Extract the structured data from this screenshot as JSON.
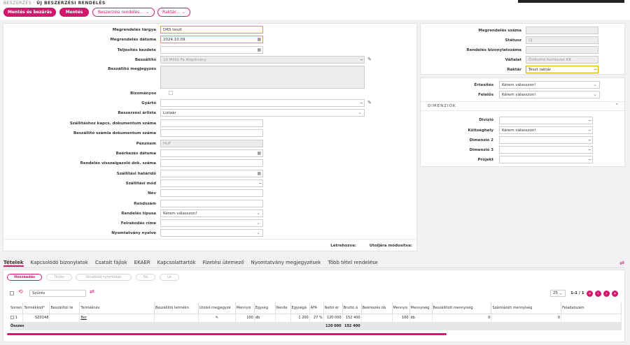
{
  "breadcrumb": {
    "root": "BESZERZÉS",
    "sep": "·",
    "current": "ÚJ BESZERZÉSI RENDELÉS"
  },
  "toolbar": {
    "save_close": "Mentés és bezárás",
    "save": "Mentés",
    "orders_menu": "Beszerzési rendelés...",
    "warehouse_menu": "Raktár..."
  },
  "form": {
    "subject_label": "Megrendelés tárgya",
    "subject_value": "DRS teszt",
    "date_label": "Megrendelés dátuma",
    "date_value": "2024.10.09.",
    "start_label": "Teljesítés kezdete",
    "start_value": "",
    "supplier_label": "Beszállító",
    "supplier_value": "10 Millió Fa Alapítvány",
    "note_label": "Beszállító megjegyzés",
    "consign_label": "Bizományos",
    "maker_label": "Gyártó",
    "pricelist_label": "Beszerzési árlista",
    "pricelist_value": "Listaár",
    "supdoc_label": "Szállításhoz kapcs. dokumentum száma",
    "invdoc_label": "Beszállító számla dokumentum száma",
    "currency_label": "Pénznem",
    "currency_value": "HUF",
    "arrival_label": "Beérkezés dátuma",
    "confirm_label": "Rendelés visszaigazoló dok. száma",
    "deadline_label": "Szállítási határidő",
    "mode_label": "Szállítási mód",
    "name_label": "Név",
    "plate_label": "Rendszám",
    "type_label": "Rendelés típusa",
    "type_value": "Kérem válasszon!",
    "unload_label": "Felrakodás címe",
    "lang_label": "Nyomtatvány nyelve",
    "created_label": "Létrehozva:",
    "modified_label": "Utoljára módosítva:"
  },
  "right": {
    "number_label": "Megrendelés száma",
    "status_label": "Státusz",
    "status_value": "Új",
    "docnum_label": "Rendelés bizonylatszáma",
    "company_label": "Vállalat",
    "company_value": "Örökzöld Kertészet Kft.",
    "warehouse_label": "Raktár",
    "warehouse_value": "Teszt raktár",
    "notify_label": "Értesítés",
    "notify_value": "Kérem válasszon!",
    "resp_label": "Felelős",
    "resp_value": "Kérem válasszon!",
    "dim_title": "DIMENZIÓK",
    "division_label": "Divízió",
    "cost_label": "Költséghely",
    "cost_value": "Kérem válasszon!",
    "dim2_label": "Dimenzió 2",
    "dim3_label": "Dimenzió 3",
    "project_label": "Projekt"
  },
  "tabs": [
    "Tételek",
    "Kapcsolódó bizonylatok",
    "Csatolt fájlok",
    "EKAER",
    "Kapcsolattartók",
    "Fizetési ütemező",
    "Nyomtatvány megjegyzések",
    "Több tétel rendelése"
  ],
  "items": {
    "add": "Hozzáadás",
    "delete": "Törlés",
    "copy_line": "Vonalkód nyomtatás",
    "up": "Fel",
    "down": "Le",
    "filter_placeholder": "Szűrés",
    "page_size": "25",
    "page_info": "1-1 / 1",
    "columns": [
      "Sorren",
      "Termékkód*",
      "Beszállítói te",
      "Terméknév",
      "Beszállítói termékn",
      "Utolsó megjegyzé",
      "Mennyis",
      "Egység",
      "Rende",
      "Egységá",
      "ÁFA",
      "Nettó ér",
      "Bruttó á",
      "Beérkezés dá",
      "Mennyis",
      "Mennyiség",
      "Beszállított mennyiség",
      "Számlázott mennyiség",
      "Feladatszám"
    ],
    "row": {
      "num": "1",
      "code": "SZ0148",
      "name": "Bor",
      "qty": "100",
      "unit": "db",
      "unit_price": "1 200",
      "vat": "27 %",
      "net": "120 000",
      "gross": "152 400",
      "qty2": "100",
      "unit2": "db",
      "delivered": "0",
      "invoiced": "0"
    },
    "total": {
      "label": "Összes",
      "net": "120 000",
      "gross": "152 400"
    }
  }
}
